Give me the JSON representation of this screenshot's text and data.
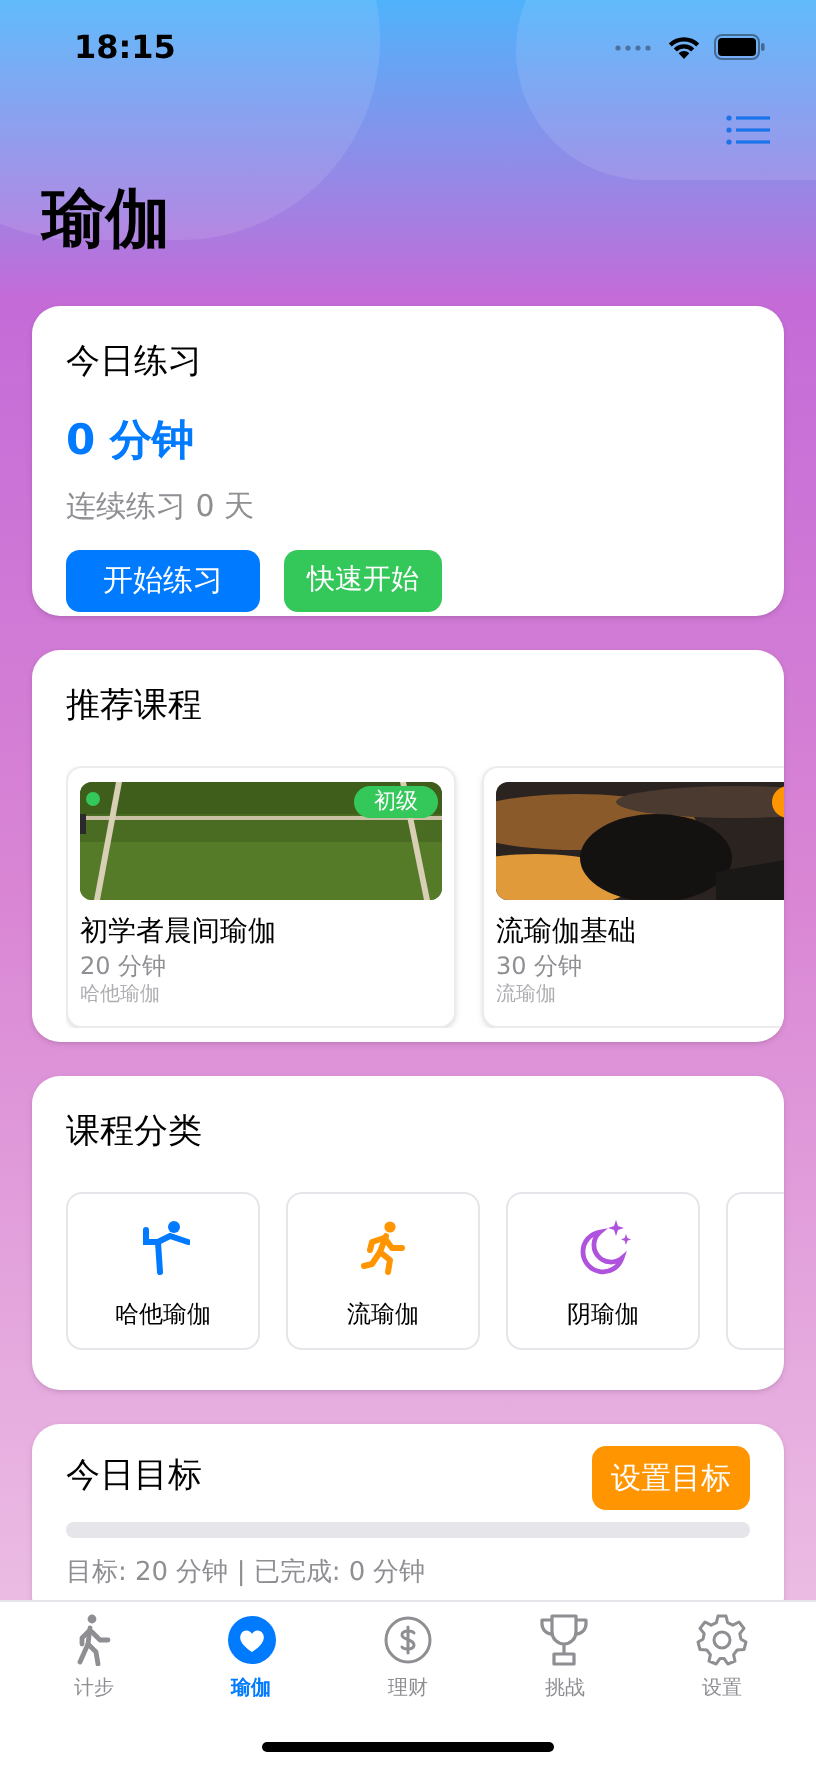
{
  "status_bar": {
    "time": "18:15"
  },
  "title": "瑜伽",
  "today": {
    "heading": "今日练习",
    "minutes": "0 分钟",
    "streak": "连续练习 0 天",
    "buttons": [
      {
        "label": "开始练习",
        "kind": "primary"
      },
      {
        "label": "快速开始",
        "kind": "secondary"
      }
    ]
  },
  "recommended": {
    "heading": "推荐课程",
    "courses": [
      {
        "title": "初学者晨间瑜伽",
        "duration": "20 分钟",
        "category": "哈他瑜伽",
        "level_badge": "初级",
        "color": "#34c759",
        "dot": true,
        "kind": "picture"
      },
      {
        "title": "流瑜伽基础",
        "duration": "30 分钟",
        "category": "流瑜伽",
        "color": "#ff9500",
        "dot": false,
        "kind": "picture"
      }
    ]
  },
  "categories": {
    "heading": "课程分类",
    "items": [
      {
        "kind": "labeled",
        "label": "哈他瑜伽",
        "color": "#007aff"
      },
      {
        "kind": "labeled",
        "label": "流瑜伽",
        "color": "#ff9500"
      },
      {
        "kind": "labeled",
        "label": "阴瑜伽",
        "color": "#af52de"
      },
      {
        "kind": "cut_off"
      }
    ]
  },
  "goal": {
    "heading": "今日目标",
    "button": "设置目标",
    "level": 0,
    "summary": "目标: 20 分钟 | 已完成: 0 分钟"
  },
  "tab_bar": [
    {
      "label": "计步",
      "selected": false
    },
    {
      "label": "瑜伽",
      "selected": true
    },
    {
      "label": "理财",
      "selected": false
    },
    {
      "label": "挑战",
      "selected": false
    },
    {
      "label": "设置",
      "selected": false
    }
  ]
}
